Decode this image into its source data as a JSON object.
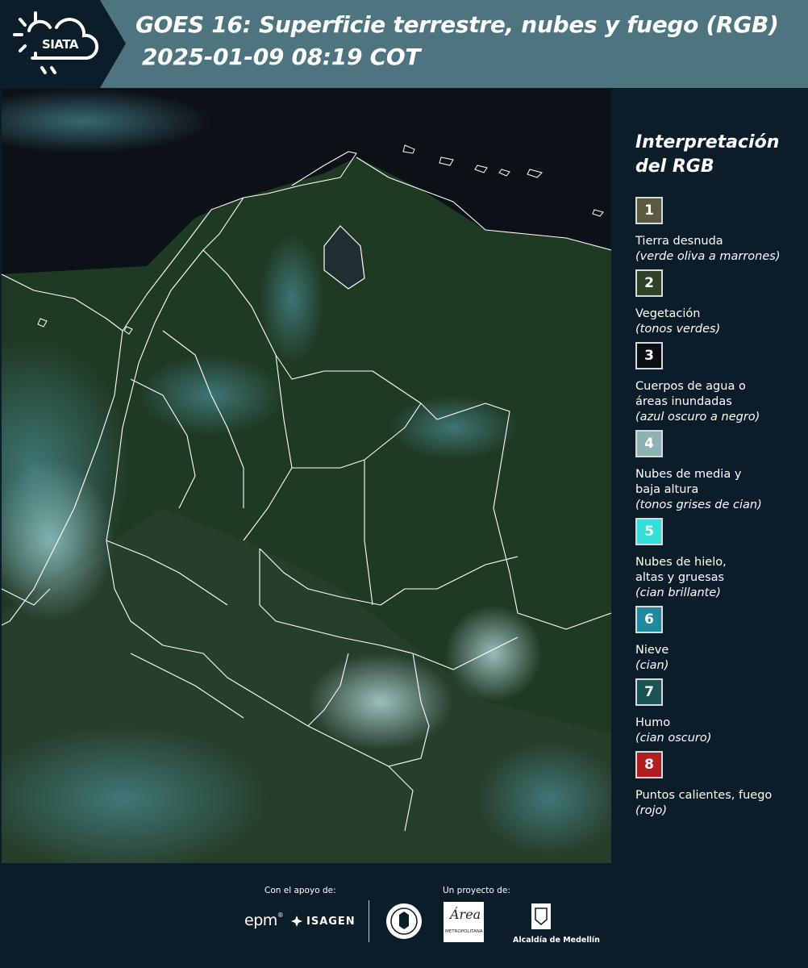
{
  "header": {
    "logo_text": "SIATA",
    "title_line1": "GOES 16: Superficie terrestre, nubes y fuego (RGB)",
    "title_line2": " 2025-01-09 08:19 COT",
    "colors": {
      "band": "#4e7480",
      "logo_bg": "#0b1d29"
    }
  },
  "map": {
    "icon": "satellite-map-image"
  },
  "legend": {
    "title": "Interpretación del RGB",
    "items": [
      {
        "number": "1",
        "label": "Tierra desnuda",
        "note": "(verde oliva a marrones)",
        "color": "#5b5a3e"
      },
      {
        "number": "2",
        "label": "Vegetación",
        "note": "(tonos verdes)",
        "color": "#2e4326"
      },
      {
        "number": "3",
        "label": "Cuerpos de agua o\náreas inundadas",
        "note": "(azul oscuro a negro)",
        "color": "#0b0f14"
      },
      {
        "number": "4",
        "label": "Nubes de media y\nbaja altura",
        "note": "(tonos grises de cian)",
        "color": "#8eb2b4"
      },
      {
        "number": "5",
        "label": "Nubes de hielo,\naltas y gruesas",
        "note": "(cian brillante)",
        "color": "#33dedb"
      },
      {
        "number": "6",
        "label": "Nieve",
        "note": "(cian)",
        "color": "#1f89a0"
      },
      {
        "number": "7",
        "label": "Humo",
        "note": "(cian oscuro)",
        "color": "#1c5355"
      },
      {
        "number": "8",
        "label": "Puntos calientes, fuego",
        "note": "(rojo)",
        "color": "#b01e22"
      }
    ]
  },
  "footer": {
    "support_label": "Con el apoyo de:",
    "project_label": "Un proyecto de:",
    "epm": "epm",
    "isagen": "ISAGEN",
    "area_word": "Área",
    "area_sub": "METROPOLITANA",
    "alcaldia": "Alcaldía de Medellín"
  }
}
